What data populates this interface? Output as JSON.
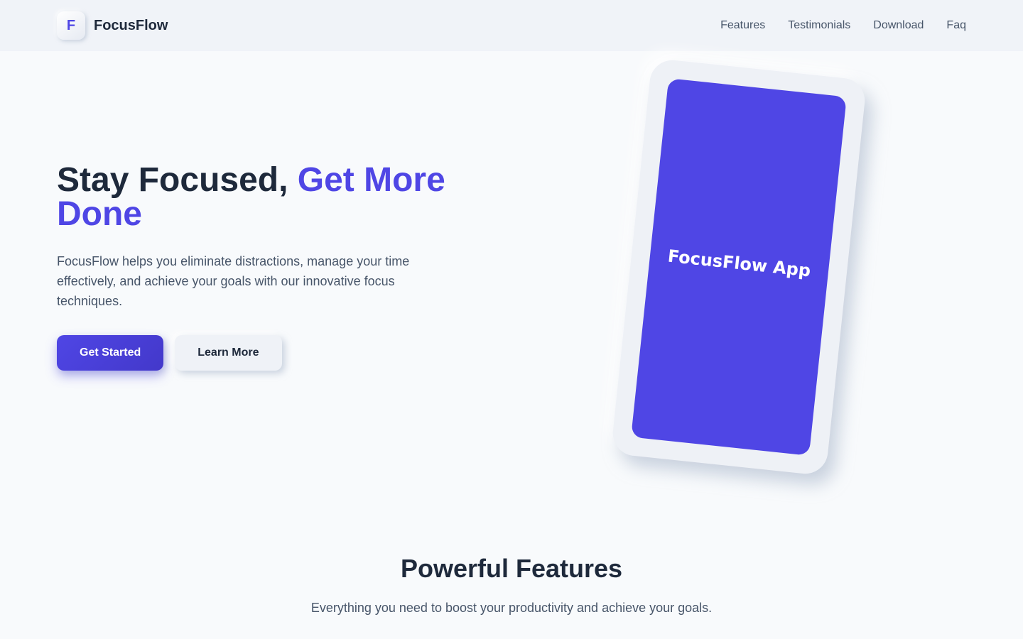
{
  "header": {
    "logo_letter": "F",
    "brand_name": "FocusFlow",
    "nav": [
      {
        "label": "Features"
      },
      {
        "label": "Testimonials"
      },
      {
        "label": "Download"
      },
      {
        "label": "Faq"
      }
    ]
  },
  "hero": {
    "title_plain": "Stay Focused, ",
    "title_accent": "Get More Done",
    "description": "FocusFlow helps you eliminate distractions, manage your time effectively, and achieve your goals with our innovative focus techniques.",
    "primary_button": "Get Started",
    "secondary_button": "Learn More",
    "phone_label": "FocusFlow App"
  },
  "features": {
    "title": "Powerful Features",
    "subtitle": "Everything you need to boost your productivity and achieve your goals."
  },
  "colors": {
    "accent": "#4f46e5",
    "text_dark": "#1e293b",
    "text_muted": "#475569",
    "background": "#f8fafc",
    "header_bg": "#f0f3f8"
  }
}
